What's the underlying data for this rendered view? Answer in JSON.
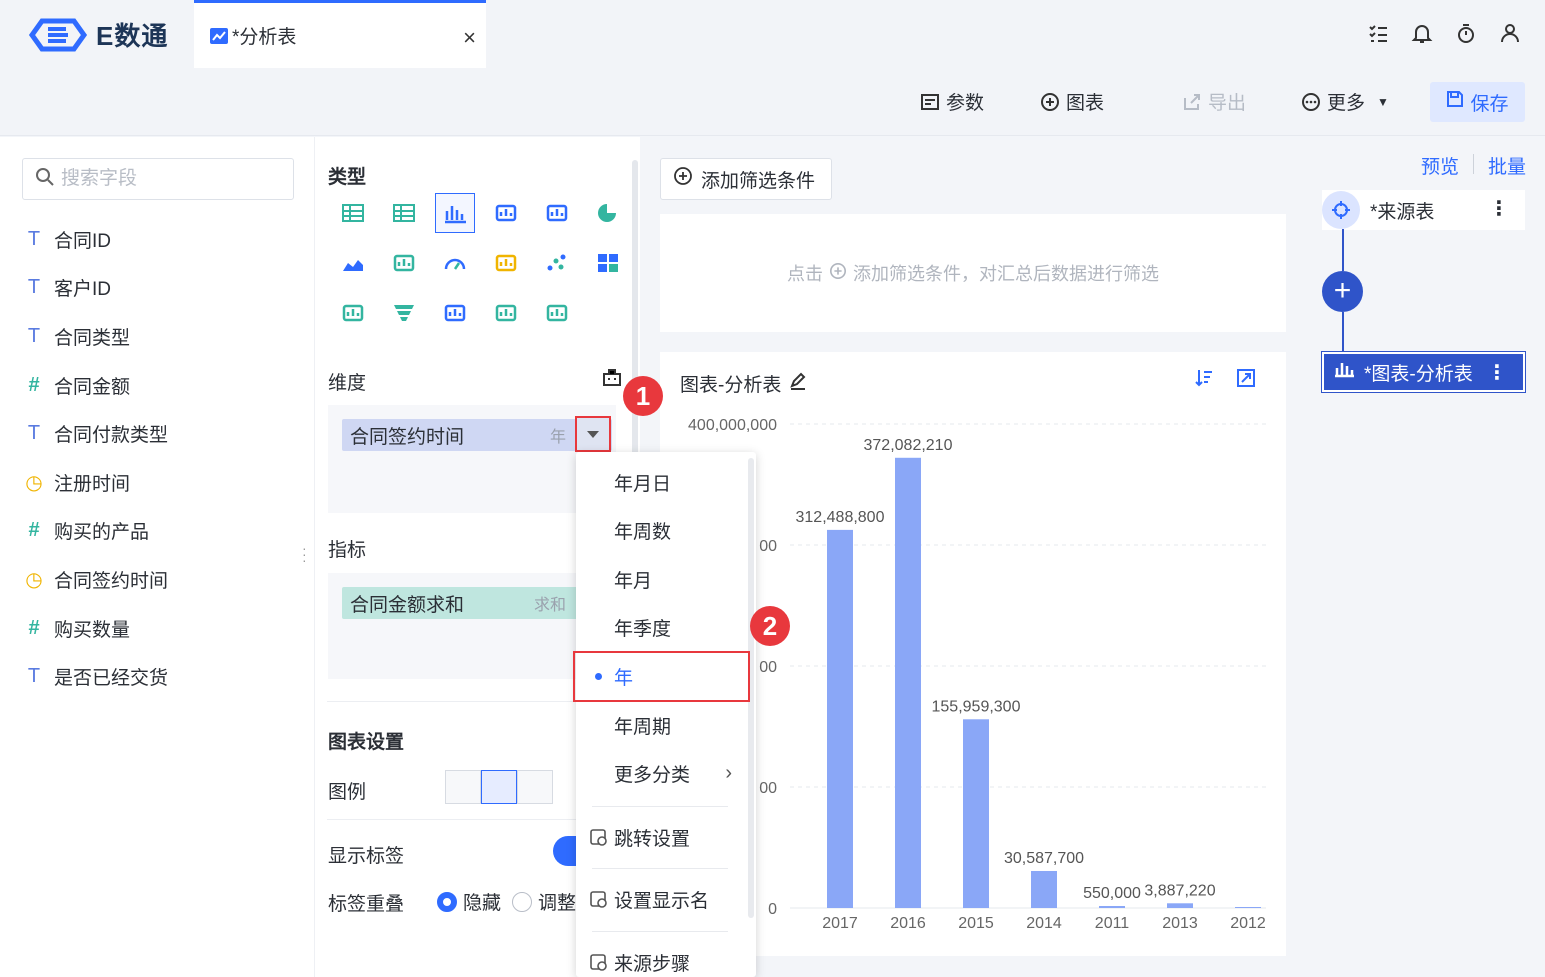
{
  "app": {
    "name": "E数通"
  },
  "tab": {
    "title": "*分析表",
    "close": "×"
  },
  "toolbar": {
    "params": "参数",
    "chart": "图表",
    "export": "导出",
    "more": "更多",
    "save": "保存"
  },
  "search": {
    "placeholder": "搜索字段"
  },
  "fields": [
    {
      "type": "T",
      "name": "合同ID"
    },
    {
      "type": "T",
      "name": "客户ID"
    },
    {
      "type": "T",
      "name": "合同类型"
    },
    {
      "type": "#",
      "name": "合同金额"
    },
    {
      "type": "T",
      "name": "合同付款类型"
    },
    {
      "type": "◷",
      "name": "注册时间"
    },
    {
      "type": "#",
      "name": "购买的产品"
    },
    {
      "type": "◷",
      "name": "合同签约时间"
    },
    {
      "type": "#",
      "name": "购买数量"
    },
    {
      "type": "T",
      "name": "是否已经交货"
    }
  ],
  "config": {
    "type_title": "类型",
    "dimension_title": "维度",
    "dimension_pill": "合同签约时间",
    "dimension_agg": "年",
    "measure_title": "指标",
    "measure_pill": "合同金额求和",
    "measure_agg": "求和",
    "settings_title": "图表设置",
    "legend_label": "图例",
    "show_label": "显示标签",
    "overlap_label": "标签重叠",
    "overlap_hide": "隐藏",
    "overlap_adjust": "调整"
  },
  "filter": {
    "add_button": "添加筛选条件",
    "hint_prefix": "点击",
    "hint_suffix": "添加筛选条件，对汇总后数据进行筛选"
  },
  "chart_card": {
    "title": "图表-分析表"
  },
  "chart_data": {
    "type": "bar",
    "categories": [
      "2017",
      "2016",
      "2015",
      "2014",
      "2011",
      "2013",
      "2012"
    ],
    "values": [
      312488800,
      372082210,
      155959300,
      30587700,
      550000,
      3887220,
      0
    ],
    "data_labels": [
      "312,488,800",
      "372,082,210",
      "155,959,300",
      "30,587,700",
      "550,000",
      "3,887,220",
      ""
    ],
    "ylim": [
      0,
      400000000
    ],
    "y_ticks": [
      0,
      100000000,
      200000000,
      300000000,
      400000000
    ],
    "y_tick_labels": [
      "0",
      "00",
      "00",
      "00",
      "400,000,000"
    ],
    "bar_color": "#8aa7f7",
    "grid": true
  },
  "flow": {
    "preview": "预览",
    "batch": "批量",
    "source_node": "*来源表",
    "chart_node": "*图表-分析表"
  },
  "menu": {
    "items": [
      "年月日",
      "年周数",
      "年月",
      "年季度",
      "年",
      "年周期",
      "更多分类"
    ],
    "selected": "年",
    "actions": [
      "跳转设置",
      "设置显示名",
      "来源步骤"
    ]
  },
  "badges": [
    "1",
    "2"
  ],
  "colors": {
    "accent": "#2f6bff",
    "highlight": "#e8383d",
    "node": "#2f54c9"
  }
}
